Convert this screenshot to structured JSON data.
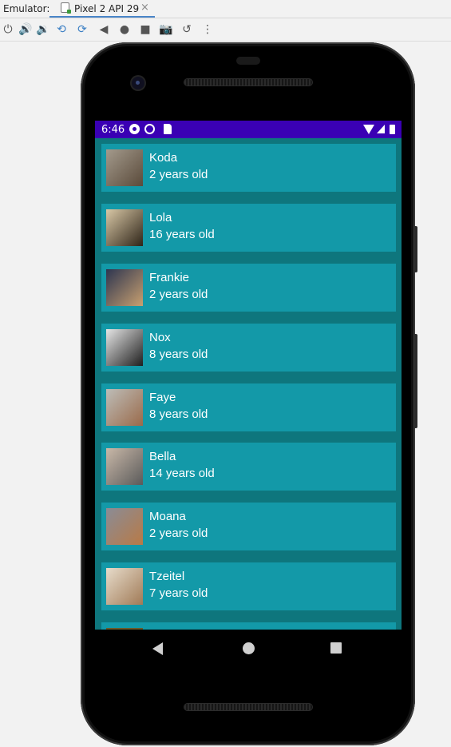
{
  "emulator": {
    "label": "Emulator:",
    "tab_title": "Pixel 2 API 29",
    "tab_close": "×",
    "toolbar_icons": [
      "power-icon",
      "volume-up-icon",
      "volume-down-icon",
      "rotate-left-icon",
      "rotate-right-icon",
      "back-icon",
      "home-icon",
      "overview-icon",
      "screenshot-icon",
      "snapshot-icon",
      "more-icon"
    ]
  },
  "status_bar": {
    "time": "6:46",
    "icons": [
      "settings-icon",
      "cast-icon",
      "sd-card-icon",
      "wifi-icon",
      "signal-icon",
      "battery-icon"
    ]
  },
  "pets": [
    {
      "name": "Koda",
      "age": "2 years old",
      "photo_colors": [
        "#a39a8c",
        "#5a4a3a"
      ]
    },
    {
      "name": "Lola",
      "age": "16 years old",
      "photo_colors": [
        "#d9c8a6",
        "#2e2418"
      ]
    },
    {
      "name": "Frankie",
      "age": "2 years old",
      "photo_colors": [
        "#2d3550",
        "#c8a070"
      ]
    },
    {
      "name": "Nox",
      "age": "8 years old",
      "photo_colors": [
        "#e6e6e6",
        "#1e1e1e"
      ]
    },
    {
      "name": "Faye",
      "age": "8 years old",
      "photo_colors": [
        "#bdbdb8",
        "#9a6a4a"
      ]
    },
    {
      "name": "Bella",
      "age": "14 years old",
      "photo_colors": [
        "#c9b8a8",
        "#5a5a5a"
      ]
    },
    {
      "name": "Moana",
      "age": "2 years old",
      "photo_colors": [
        "#8a8c96",
        "#b87a46"
      ]
    },
    {
      "name": "Tzeitel",
      "age": "7 years old",
      "photo_colors": [
        "#e7dccb",
        "#a07a56"
      ]
    }
  ],
  "colors": {
    "list_background": "#0e767d",
    "card": "#1399a8",
    "status_bar": "#3a00b4"
  },
  "nav_bar": {
    "icons": [
      "back-icon",
      "home-icon",
      "recents-icon"
    ]
  }
}
